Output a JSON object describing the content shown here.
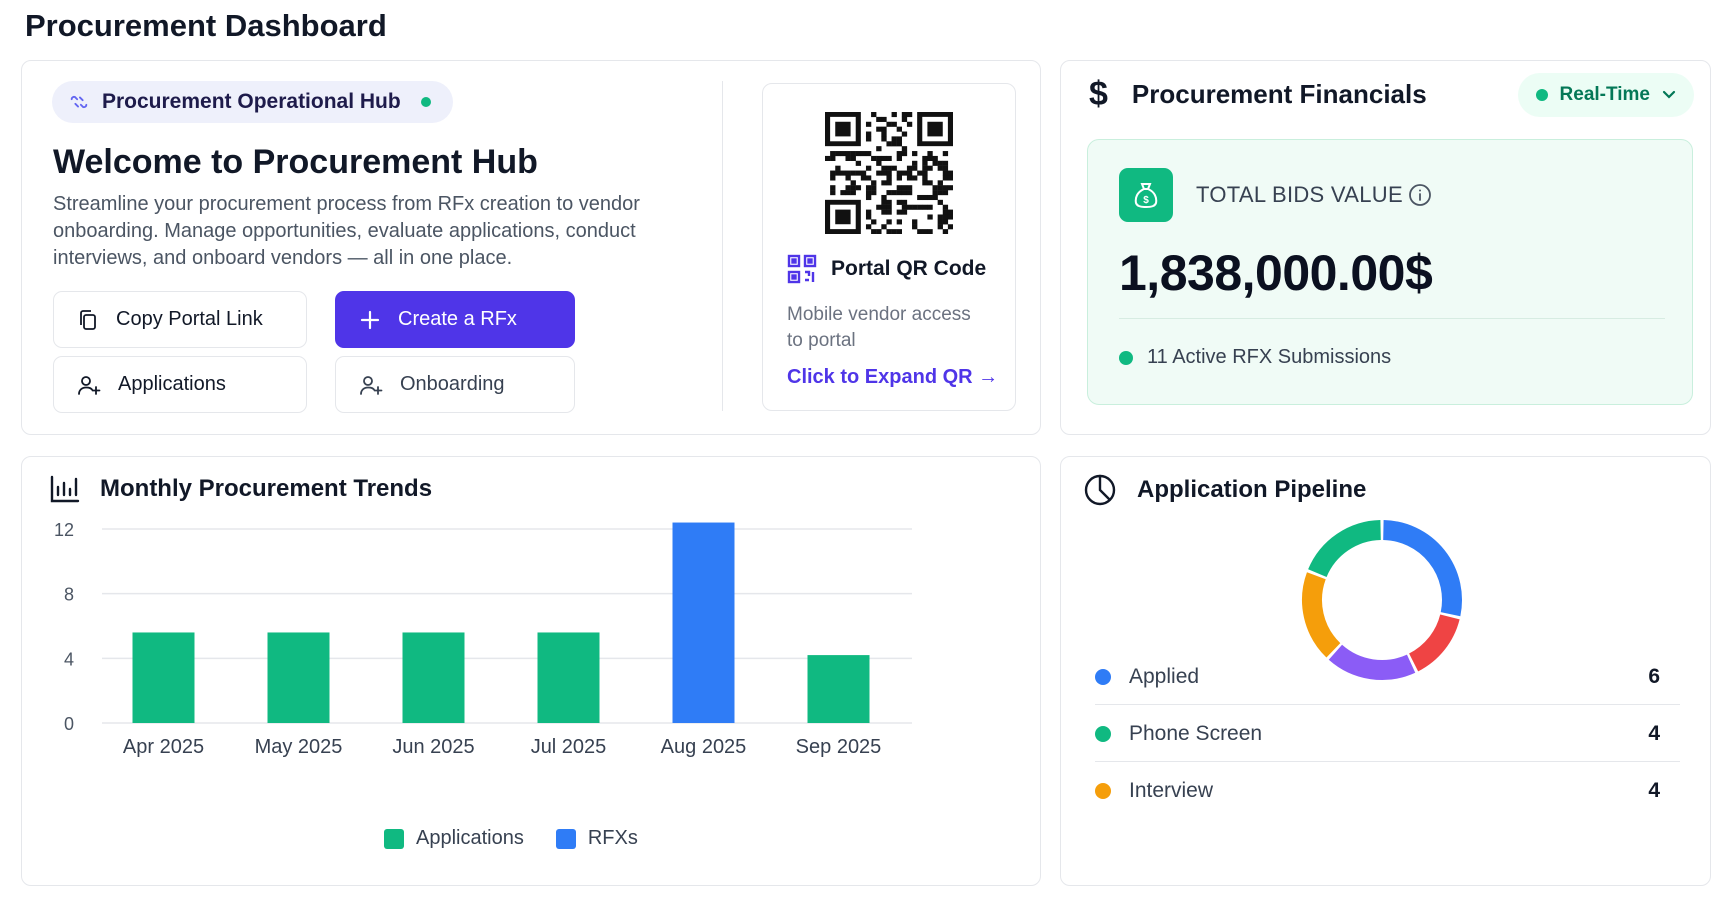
{
  "page_title": "Procurement Dashboard",
  "welcome": {
    "hub_label": "Procurement Operational Hub",
    "title": "Welcome to Procurement Hub",
    "description": "Streamline your procurement process from RFx creation to vendor onboarding. Manage opportunities, evaluate applications, conduct interviews, and onboard vendors — all in one place.",
    "buttons": {
      "copy_portal": "Copy Portal Link",
      "create_rfx": "Create a RFx",
      "applications": "Applications",
      "onboarding": "Onboarding"
    },
    "qr": {
      "title": "Portal QR Code",
      "subtitle": "Mobile vendor access to portal",
      "expand_link": "Click to Expand QR →"
    }
  },
  "financials": {
    "title": "Procurement Financials",
    "currency_symbol": "$",
    "mode": "Real-Time",
    "total_label": "TOTAL BIDS VALUE",
    "total_value": "1,838,000.00$",
    "active_submissions": "11 Active RFX Submissions",
    "accent_color": "#10b981"
  },
  "trends": {
    "title": "Monthly Procurement Trends",
    "legend": {
      "applications": "Applications",
      "rfxs": "RFXs"
    }
  },
  "chart_data": {
    "type": "bar",
    "categories": [
      "Apr 2025",
      "May 2025",
      "Jun 2025",
      "Jul 2025",
      "Aug 2025",
      "Sep 2025"
    ],
    "series": [
      {
        "name": "Applications",
        "color": "#10b981",
        "values": [
          5.6,
          5.6,
          5.6,
          5.6,
          null,
          4.2
        ]
      },
      {
        "name": "RFXs",
        "color": "#2f7cf6",
        "values": [
          null,
          null,
          null,
          null,
          12.4,
          null
        ]
      }
    ],
    "y_ticks": [
      "0",
      "4",
      "8",
      "12"
    ],
    "ylim": [
      0,
      12
    ],
    "grid": true,
    "legend_position": "bottom-center"
  },
  "pipeline": {
    "title": "Application Pipeline",
    "stages": [
      {
        "label": "Applied",
        "count": "6",
        "color": "#2f7cf6"
      },
      {
        "label": "Phone Screen",
        "count": "4",
        "color": "#10b981"
      },
      {
        "label": "Interview",
        "count": "4",
        "color": "#f59e0b"
      }
    ],
    "donut_segments": [
      {
        "color": "#2f7cf6",
        "value": 6
      },
      {
        "color": "#ef4444",
        "value": 3
      },
      {
        "color": "#8b5cf6",
        "value": 4
      },
      {
        "color": "#f59e0b",
        "value": 4
      },
      {
        "color": "#10b981",
        "value": 4
      }
    ]
  }
}
